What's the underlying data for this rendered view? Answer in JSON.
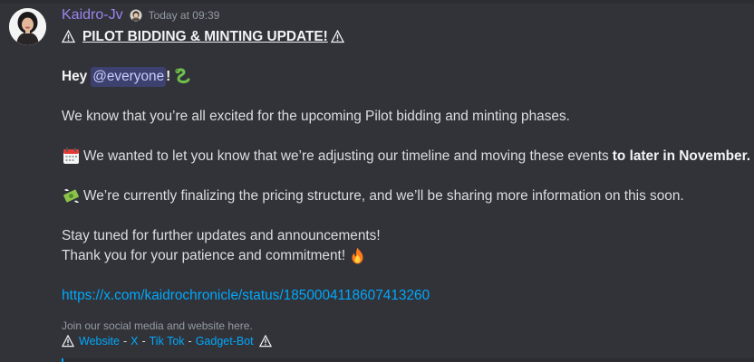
{
  "message": {
    "author": "Kaidro-Jv",
    "timestamp": "Today at 09:39",
    "heading": "PILOT BIDDING & MINTING UPDATE!",
    "greeting_prefix": "Hey",
    "mention": "@everyone",
    "greeting_suffix": "!",
    "para1": "We know that you’re all excited for the upcoming Pilot bidding and minting phases.",
    "para2_text": "We wanted to let you know that we’re adjusting our timeline and moving these events",
    "para2_bold": "to later in November.",
    "para3": "We’re currently finalizing the pricing structure, and we’ll be sharing more information on this soon.",
    "para4_line1": "Stay tuned for further updates and announcements!",
    "para4_line2": "Thank you for your patience and commitment!",
    "link": "https://x.com/kaidrochronicle/status/1850004118607413260",
    "footer_note": "Join our social media and website here.",
    "footer_links": {
      "website": "Website",
      "x": "X",
      "tiktok": "Tik Tok",
      "gadget": "Gadget-Bot",
      "separator": "-"
    }
  },
  "icons": {
    "warning": "warning-sign-icon",
    "snake": "snake-emoji-icon",
    "calendar": "calendar-emoji-icon",
    "money": "money-with-wings-emoji-icon",
    "fire": "fire-emoji-icon"
  },
  "colors": {
    "background": "#323339",
    "username": "#9b84ee",
    "link": "#00a8fc",
    "mention_bg": "#4e54a8"
  }
}
